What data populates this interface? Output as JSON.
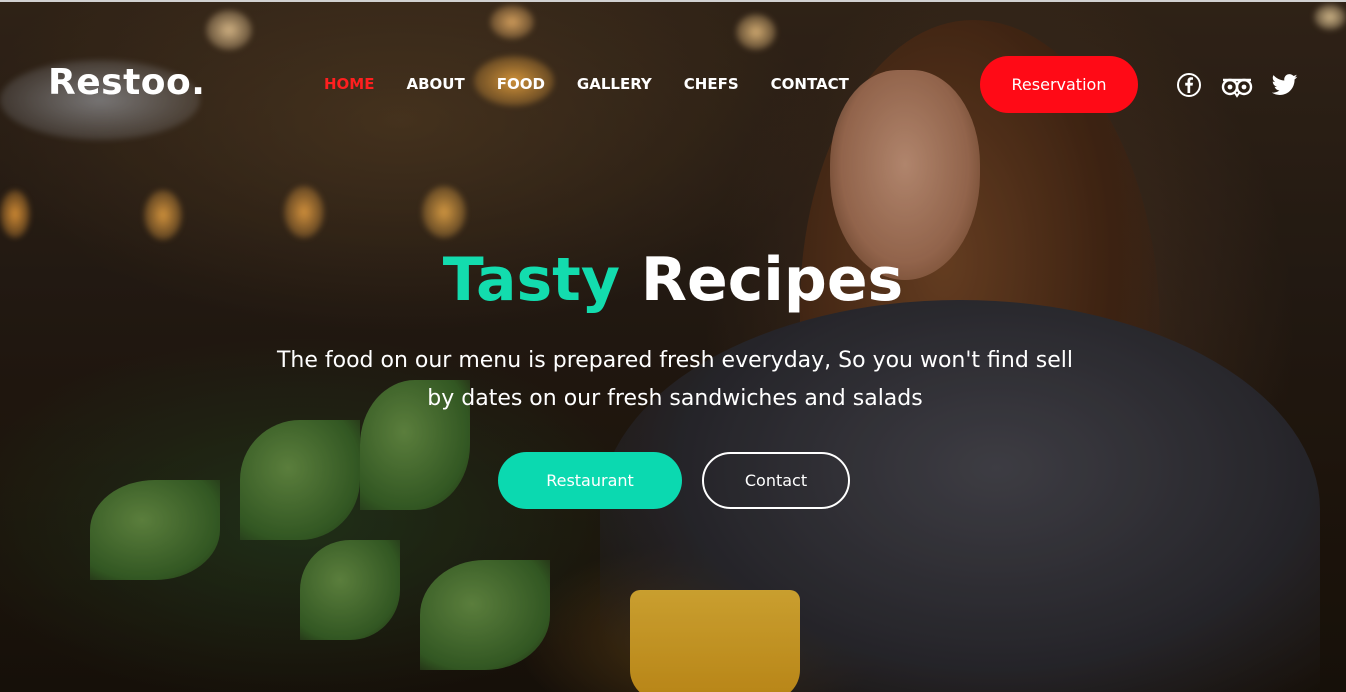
{
  "brand": {
    "logo": "Restoo."
  },
  "nav": {
    "items": [
      {
        "label": "HOME",
        "active": true
      },
      {
        "label": "ABOUT",
        "active": false
      },
      {
        "label": "FOOD",
        "active": false
      },
      {
        "label": "GALLERY",
        "active": false
      },
      {
        "label": "CHEFS",
        "active": false
      },
      {
        "label": "CONTACT",
        "active": false
      }
    ]
  },
  "header": {
    "reservation_label": "Reservation",
    "social_icons": [
      "facebook-icon",
      "tripadvisor-icon",
      "twitter-icon"
    ]
  },
  "hero": {
    "title_accent": "Tasty",
    "title_main": "Recipes",
    "subtitle": "The food on our menu is prepared fresh everyday, So you won't find sell by dates on our fresh sandwiches and salads",
    "primary_button": "Restaurant",
    "secondary_button": "Contact"
  },
  "colors": {
    "accent": "#13dcae",
    "primary_button": "#0bd9b0",
    "reservation": "#ff0a16",
    "active_nav": "#ff1f1f",
    "text": "#ffffff"
  }
}
